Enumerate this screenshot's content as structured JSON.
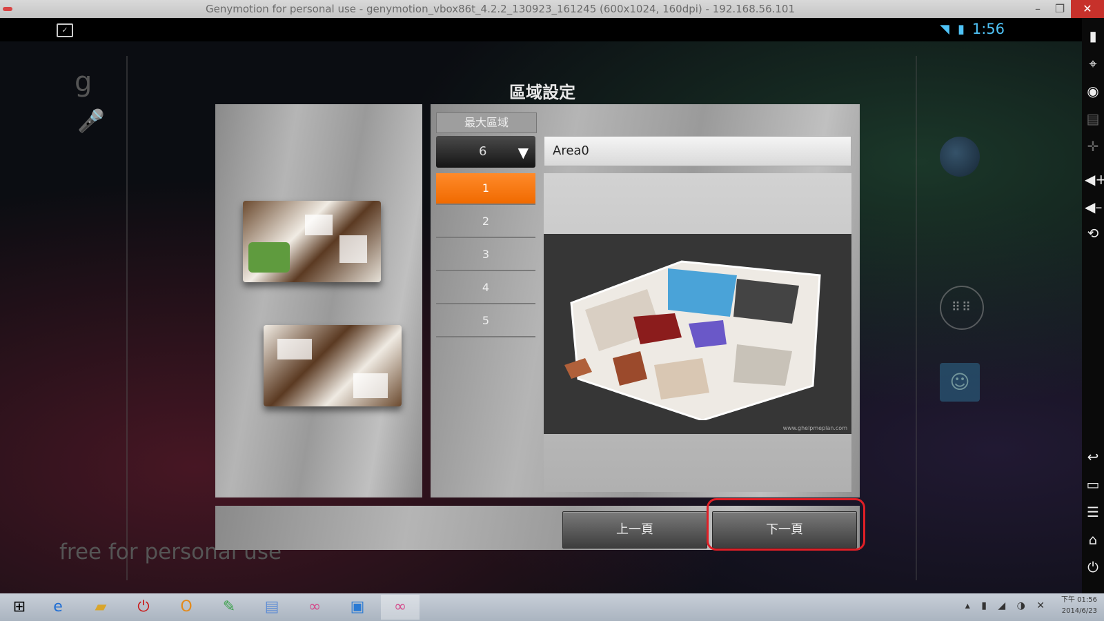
{
  "window": {
    "title": "Genymotion for personal use - genymotion_vbox86t_4.2.2_130923_161245 (600x1024, 160dpi) - 192.168.56.101",
    "minimize_icon": "minimize-icon",
    "restore_icon": "restore-icon",
    "close_icon": "close-icon"
  },
  "status_bar": {
    "time": "1:56",
    "wifi_icon": "wifi-icon",
    "battery_icon": "battery-icon",
    "notification_icon": "screenshot-notification-icon"
  },
  "dialog": {
    "title": "區域設定",
    "section_label": "最大區域",
    "max_area_select": "6",
    "area_name": "Area0",
    "area_list": [
      "1",
      "2",
      "3",
      "4",
      "5"
    ],
    "selected_area": "1",
    "preview_credit": "www.ghelpmeplan.com",
    "prev_button": "上一頁",
    "next_button": "下一頁"
  },
  "watermark": "free for personal use",
  "colors": {
    "accent_orange": "#f57c1f",
    "highlight_red": "#e01f26",
    "statusbar_blue": "#4fc3f7"
  },
  "taskbar": {
    "clock_time": "下午 01:56",
    "clock_date": "2014/6/23",
    "apps": [
      "windows-start-icon",
      "internet-explorer-icon",
      "file-explorer-icon",
      "power-app-icon",
      "outlook-icon",
      "paint-icon",
      "notepad-icon",
      "genymotion-icon",
      "remote-desktop-icon",
      "genymotion-active-icon"
    ]
  },
  "genymotion_toolbar": [
    "battery-widget-icon",
    "gps-icon",
    "camera-icon",
    "media-icon",
    "dpad-icon",
    "volume-up-icon",
    "volume-down-icon",
    "rotate-icon",
    "back-icon",
    "recent-apps-icon",
    "menu-icon",
    "home-icon",
    "power-icon"
  ]
}
